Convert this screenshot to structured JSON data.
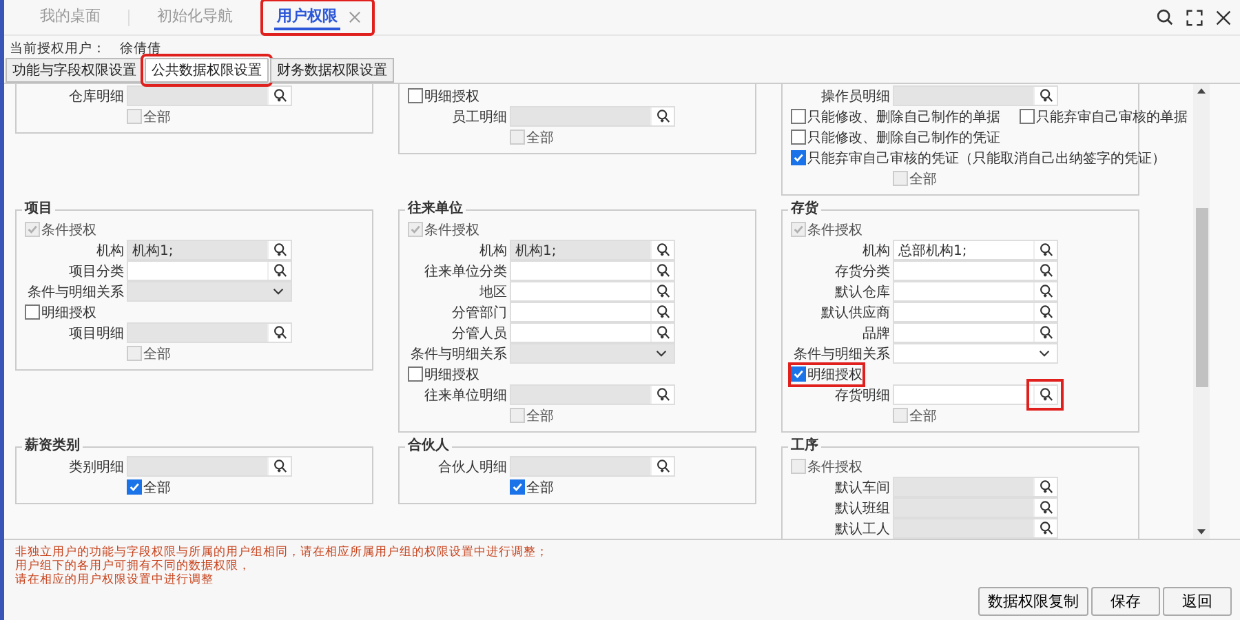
{
  "tabs": [
    {
      "label": "我的桌面",
      "selected": false,
      "highlighted": false
    },
    {
      "label": "初始化导航",
      "selected": false,
      "highlighted": false
    },
    {
      "label": "用户权限",
      "selected": true,
      "highlighted": true
    }
  ],
  "current_user": {
    "label": "当前授权用户：",
    "value": "徐倩倩"
  },
  "subtabs": [
    {
      "label": "功能与字段权限设置",
      "selected": false,
      "highlighted": false
    },
    {
      "label": "公共数据权限设置",
      "selected": true,
      "highlighted": true
    },
    {
      "label": "财务数据权限设置",
      "selected": false,
      "highlighted": false
    }
  ],
  "sections": [
    {
      "panels": [
        {
          "rows": [
            {
              "kind": "lookup",
              "label": "仓库明细",
              "value": "",
              "disabled": true
            },
            {
              "kind": "all",
              "label": "全部",
              "checked": false,
              "disabled": true
            }
          ]
        },
        {
          "rows": [
            {
              "kind": "check",
              "items": [
                {
                  "label": "明细授权",
                  "checked": false,
                  "disabled": false
                }
              ]
            },
            {
              "kind": "lookup",
              "label": "员工明细",
              "value": "",
              "disabled": true
            },
            {
              "kind": "all",
              "label": "全部",
              "checked": false,
              "disabled": true
            }
          ]
        },
        {
          "rows": [
            {
              "kind": "lookup",
              "label": "操作员明细",
              "value": "",
              "disabled": true
            },
            {
              "kind": "check",
              "items": [
                {
                  "label": "只能修改、删除自己制作的单据",
                  "checked": false,
                  "disabled": false
                },
                {
                  "label": "只能弃审自己审核的单据",
                  "checked": false,
                  "disabled": false
                }
              ]
            },
            {
              "kind": "check",
              "items": [
                {
                  "label": "只能修改、删除自己制作的凭证",
                  "checked": false,
                  "disabled": false
                }
              ]
            },
            {
              "kind": "check",
              "items": [
                {
                  "label": "只能弃审自己审核的凭证（只能取消自己出纳签字的凭证）",
                  "checked": true,
                  "disabled": false
                }
              ]
            },
            {
              "kind": "all",
              "label": "全部",
              "checked": false,
              "disabled": true
            }
          ]
        }
      ]
    },
    {
      "panels": [
        {
          "title": "项目",
          "rows": [
            {
              "kind": "check",
              "items": [
                {
                  "label": "条件授权",
                  "checked": true,
                  "disabled": true
                }
              ]
            },
            {
              "kind": "lookup",
              "label": "机构",
              "value": "机构1;",
              "disabled": true
            },
            {
              "kind": "lookup",
              "label": "项目分类",
              "value": "",
              "disabled": false
            },
            {
              "kind": "select",
              "label": "条件与明细关系",
              "disabled": true
            },
            {
              "kind": "check",
              "items": [
                {
                  "label": "明细授权",
                  "checked": false,
                  "disabled": false
                }
              ]
            },
            {
              "kind": "lookup",
              "label": "项目明细",
              "value": "",
              "disabled": true
            },
            {
              "kind": "all",
              "label": "全部",
              "checked": false,
              "disabled": true
            }
          ]
        },
        {
          "title": "往来单位",
          "rows": [
            {
              "kind": "check",
              "items": [
                {
                  "label": "条件授权",
                  "checked": true,
                  "disabled": true
                }
              ]
            },
            {
              "kind": "lookup",
              "label": "机构",
              "value": "机构1;",
              "disabled": true
            },
            {
              "kind": "lookup",
              "label": "往来单位分类",
              "value": "",
              "disabled": false
            },
            {
              "kind": "lookup",
              "label": "地区",
              "value": "",
              "disabled": false
            },
            {
              "kind": "lookup",
              "label": "分管部门",
              "value": "",
              "disabled": false
            },
            {
              "kind": "lookup",
              "label": "分管人员",
              "value": "",
              "disabled": false
            },
            {
              "kind": "select",
              "label": "条件与明细关系",
              "disabled": true
            },
            {
              "kind": "check",
              "items": [
                {
                  "label": "明细授权",
                  "checked": false,
                  "disabled": false
                }
              ]
            },
            {
              "kind": "lookup",
              "label": "往来单位明细",
              "value": "",
              "disabled": true
            },
            {
              "kind": "all",
              "label": "全部",
              "checked": false,
              "disabled": true
            }
          ]
        },
        {
          "title": "存货",
          "rows": [
            {
              "kind": "check",
              "items": [
                {
                  "label": "条件授权",
                  "checked": true,
                  "disabled": true
                }
              ]
            },
            {
              "kind": "lookup",
              "label": "机构",
              "value": "总部机构1;",
              "disabled": false
            },
            {
              "kind": "lookup",
              "label": "存货分类",
              "value": "",
              "disabled": false
            },
            {
              "kind": "lookup",
              "label": "默认仓库",
              "value": "",
              "disabled": false
            },
            {
              "kind": "lookup",
              "label": "默认供应商",
              "value": "",
              "disabled": false
            },
            {
              "kind": "lookup",
              "label": "品牌",
              "value": "",
              "disabled": false
            },
            {
              "kind": "select",
              "label": "条件与明细关系",
              "disabled": false
            },
            {
              "kind": "check",
              "items": [
                {
                  "label": "明细授权",
                  "checked": true,
                  "disabled": false,
                  "highlighted": true
                }
              ]
            },
            {
              "kind": "lookup",
              "label": "存货明细",
              "value": "",
              "disabled": false,
              "highlighted": true
            },
            {
              "kind": "all",
              "label": "全部",
              "checked": false,
              "disabled": true
            }
          ]
        }
      ]
    },
    {
      "panels": [
        {
          "title": "薪资类别",
          "rows": [
            {
              "kind": "lookup",
              "label": "类别明细",
              "value": "",
              "disabled": true
            },
            {
              "kind": "all",
              "label": "全部",
              "checked": true,
              "disabled": false
            }
          ]
        },
        {
          "title": "合伙人",
          "rows": [
            {
              "kind": "lookup",
              "label": "合伙人明细",
              "value": "",
              "disabled": true
            },
            {
              "kind": "all",
              "label": "全部",
              "checked": true,
              "disabled": false
            }
          ]
        },
        {
          "title": "工序",
          "rows": [
            {
              "kind": "check",
              "items": [
                {
                  "label": "条件授权",
                  "checked": false,
                  "disabled": true
                }
              ]
            },
            {
              "kind": "lookup",
              "label": "默认车间",
              "value": "",
              "disabled": true
            },
            {
              "kind": "lookup",
              "label": "默认班组",
              "value": "",
              "disabled": true
            },
            {
              "kind": "lookup",
              "label": "默认工人",
              "value": "",
              "disabled": true
            }
          ]
        }
      ]
    }
  ],
  "notes": [
    "非独立用户的功能与字段权限与所属的用户组相同，请在相应所属用户组的权限设置中进行调整；",
    "用户组下的各用户可拥有不同的数据权限，",
    "请在相应的用户权限设置中进行调整"
  ],
  "buttons": [
    "数据权限复制",
    "保存",
    "返回"
  ]
}
